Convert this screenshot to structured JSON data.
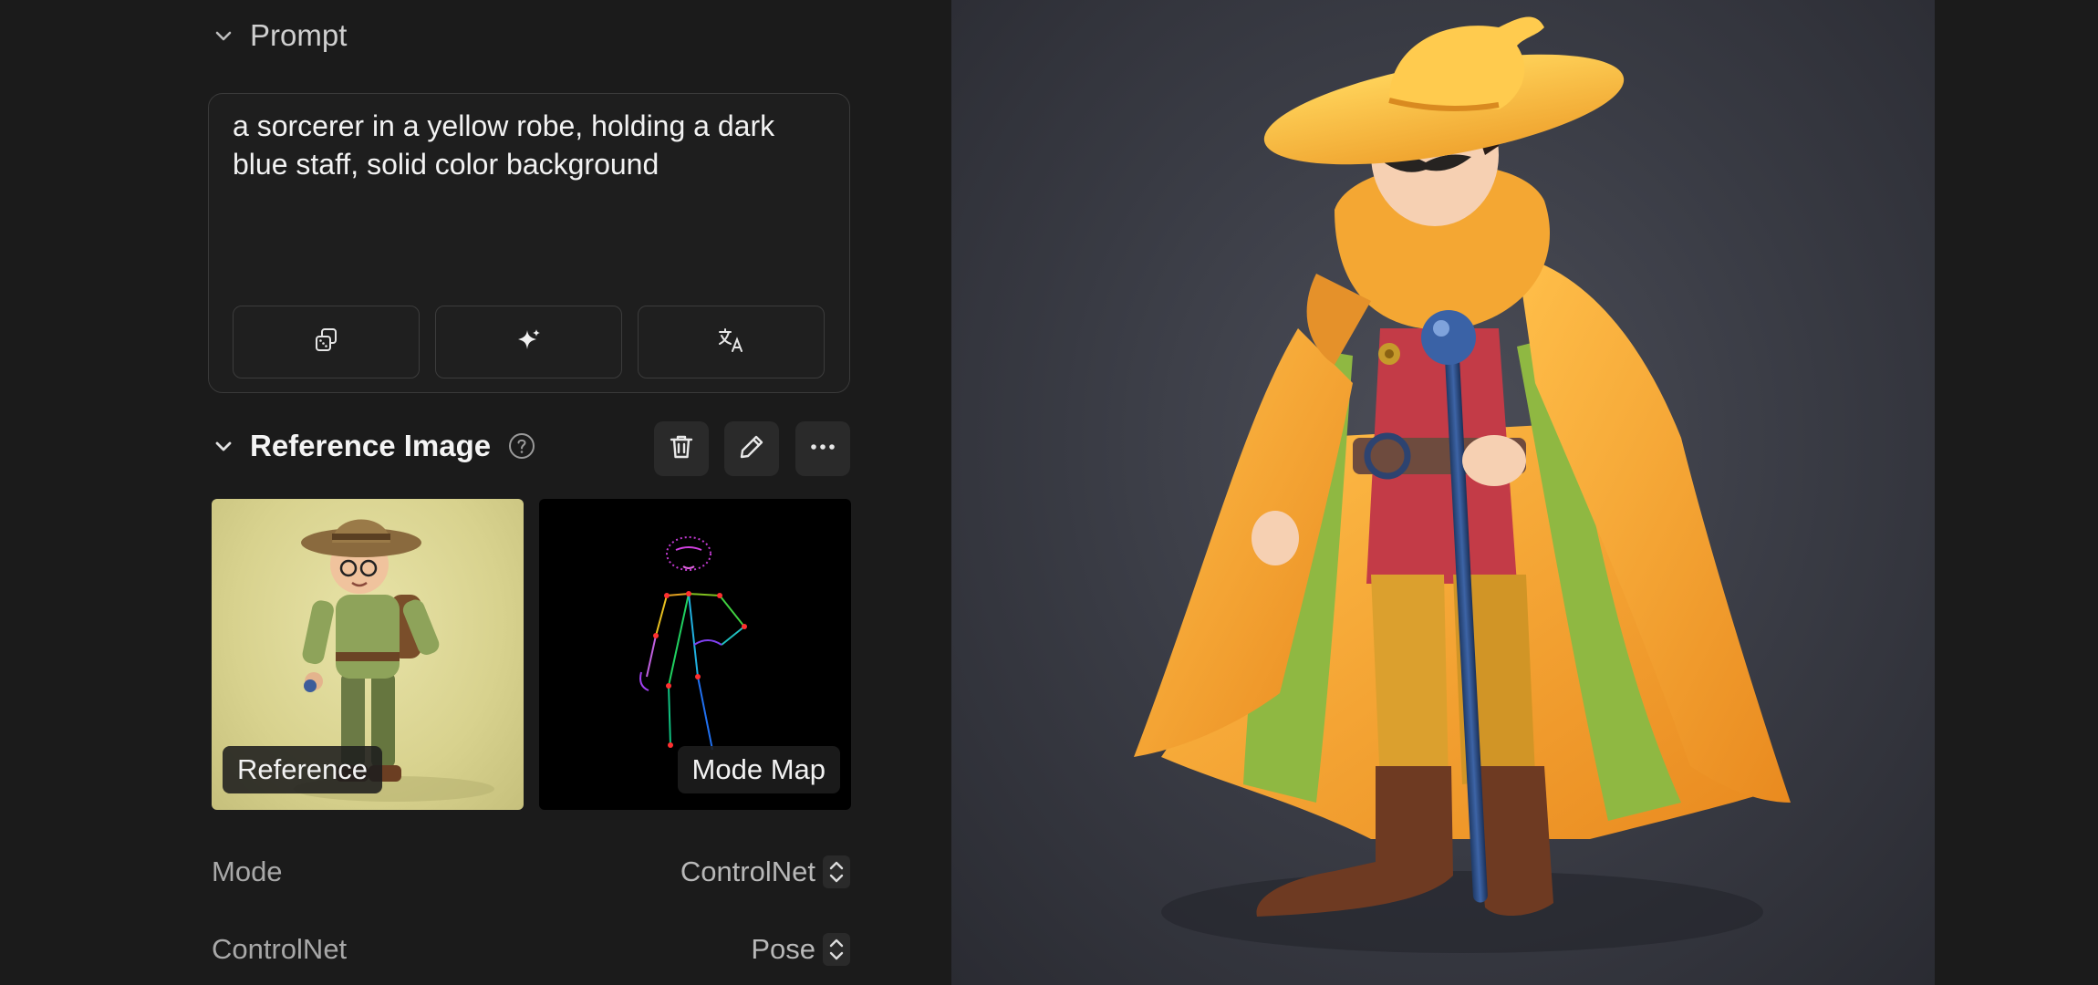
{
  "prompt_section": {
    "title": "Prompt",
    "text": "a sorcerer in a yellow robe, holding a dark blue staff, solid color background",
    "buttons": [
      {
        "icon": "dice-icon"
      },
      {
        "icon": "sparkle-icon"
      },
      {
        "icon": "translate-icon"
      }
    ]
  },
  "reference_section": {
    "title": "Reference Image",
    "help_icon": "help-icon",
    "actions": [
      {
        "icon": "trash-icon"
      },
      {
        "icon": "pencil-icon"
      },
      {
        "icon": "more-icon"
      }
    ],
    "thumbnails": [
      {
        "label": "Reference"
      },
      {
        "label": "Mode Map"
      }
    ]
  },
  "settings": {
    "mode": {
      "label": "Mode",
      "value": "ControlNet"
    },
    "controlnet": {
      "label": "ControlNet",
      "value": "Pose"
    }
  },
  "colors": {
    "panel_bg": "#1b1b1b",
    "canvas_bg": "#3a3c45",
    "robe": "#f2a431",
    "staff": "#2b4f8a"
  }
}
